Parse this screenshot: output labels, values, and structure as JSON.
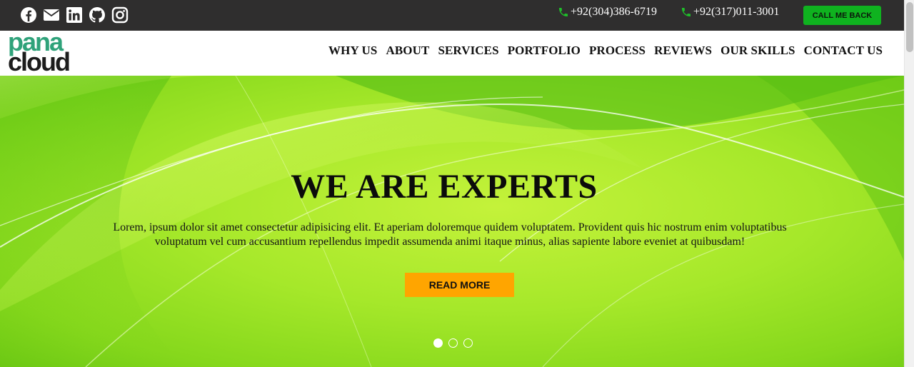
{
  "topbar": {
    "social_icons": [
      "facebook-icon",
      "envelope-icon",
      "linkedin-icon",
      "github-icon",
      "instagram-icon"
    ],
    "phones": [
      "+92(304)386-6719",
      "+92(317)011-3001"
    ],
    "call_button": "CALL ME BACK"
  },
  "brand": {
    "line1": "pana",
    "line2": "cloud"
  },
  "nav": {
    "items": [
      "WHY US",
      "ABOUT",
      "SERVICES",
      "PORTFOLIO",
      "PROCESS",
      "REVIEWS",
      "OUR SKILLS",
      "CONTACT US"
    ]
  },
  "hero": {
    "title": "WE ARE EXPERTS",
    "text": "Lorem, ipsum dolor sit amet consectetur adipisicing elit. Et aperiam doloremque quidem voluptatem. Provident quis hic nostrum enim voluptatibus voluptatum vel cum accusantium repellendus impedit assumenda animi itaque minus, alias sapiente labore eveniet at quibusdam!",
    "button": "READ MORE",
    "slides": 3,
    "active_slide": 1
  },
  "colors": {
    "topbar_bg": "#2f2e2e",
    "accent_green": "#0fb21f",
    "phone_icon": "#1fbf2a",
    "logo_teal": "#2fa27a",
    "hero_green": "#a6e82a",
    "read_more_bg": "#ffa500"
  }
}
